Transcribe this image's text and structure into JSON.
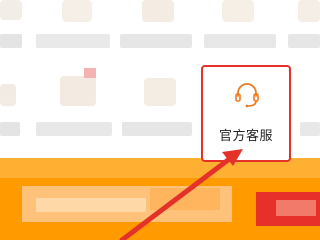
{
  "service": {
    "label": "官方客服",
    "icon": "headset-icon"
  },
  "colors": {
    "highlight_border": "#e4322b",
    "arrow": "#e4322b",
    "icon_accent": "#f07b1e",
    "banner": "#ff9a00"
  }
}
